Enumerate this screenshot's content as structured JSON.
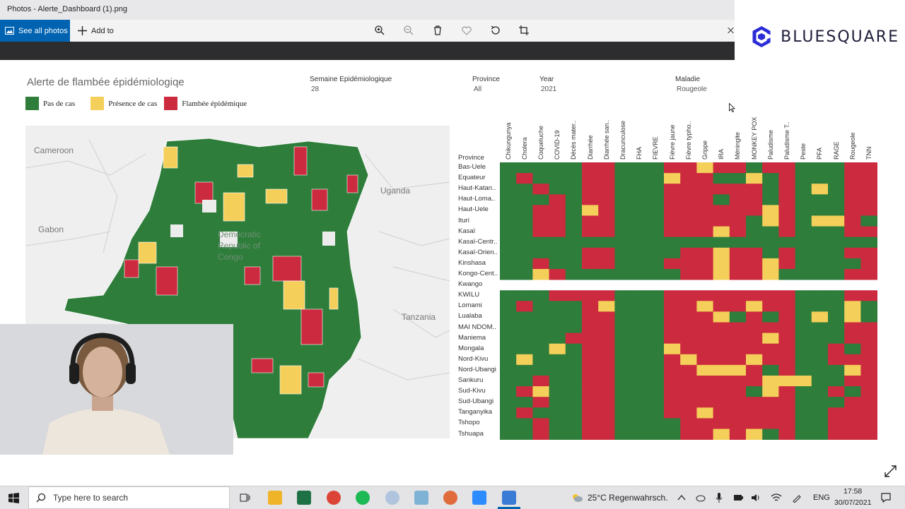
{
  "window": {
    "title": "Photos - Alerte_Dashboard (1).png"
  },
  "toolbar": {
    "see_all_label": "See all photos",
    "add_to_label": "Add to"
  },
  "brand": {
    "name": "BLUESQUARE",
    "color": "#2b2bd8"
  },
  "dashboard": {
    "title": "Alerte de flambée épidémiologiqe",
    "legend": [
      {
        "label": "Pas de cas",
        "color": "#2e7d3b"
      },
      {
        "label": "Présence de cas",
        "color": "#f4cf5a"
      },
      {
        "label": "Flambée épidémique",
        "color": "#cc2a3e"
      }
    ],
    "filters": {
      "semaine": {
        "label": "Semaine Epidémiologique",
        "value": "28"
      },
      "province": {
        "label": "Province",
        "value": "All"
      },
      "year": {
        "label": "Year",
        "value": "2021"
      },
      "maladie": {
        "label": "Maladie",
        "value": "Rougeole"
      }
    },
    "map_labels": [
      "Cameroon",
      "Gabon",
      "Uganda",
      "Tanzania",
      "Democratic Republic of Congo"
    ],
    "province_header": "Province"
  },
  "chart_data": {
    "type": "heatmap",
    "columns": [
      "Chikungunya",
      "Cholera",
      "Coqueluche",
      "COVID-19",
      "Décès mater..",
      "Diarrhée",
      "Diarrhée san..",
      "Dracunculose",
      "FHA",
      "FIEVRE",
      "Fièvre jaune",
      "Fièvre typho..",
      "Grippe",
      "IRA",
      "Méningite",
      "MONKEY POX",
      "Paludisme",
      "Paludisme T..",
      "Peste",
      "PFA",
      "RAGE",
      "Rougeole",
      "TNN"
    ],
    "rows": [
      "Bas-Uele",
      "Equateur",
      "Haut-Katan..",
      "Haut-Loma..",
      "Haut-Uele",
      "Ituri",
      "Kasaï",
      "Kasaï-Centr..",
      "Kasaï-Orien..",
      "Kinshasa",
      "Kongo-Cent..",
      "Kwango",
      "KWILU",
      "Lomami",
      "Lualaba",
      "MAI NDOM..",
      "Maniema",
      "Mongala",
      "Nord-Kivu",
      "Nord-Ubangi",
      "Sankuru",
      "Sud-Kivu",
      "Sud-Ubangi",
      "Tanganyika",
      "Tshopo",
      "Tshuapa"
    ],
    "legend": {
      "0": "Pas de cas",
      "1": "Présence de cas",
      "2": "Flambée épidémique"
    },
    "values": [
      "00000220002212202200022",
      "02000220001220010200022",
      "00200220002222220201022",
      "00020220002220220200022",
      "00220120002222221200022",
      "00220220002222201201120",
      "00220220002221200200022",
      "00000000000000000000000",
      "00000220000221220200022",
      "00200220002221221200002",
      "00120000000221221000022",
      "",
      "00022220002222222200022",
      "02000210002212212200010",
      "00000220002221020201010",
      "00000220002222222200022",
      "00002220002222221200022",
      "00010220001222222200202",
      "01000220002122212200222",
      "00000220002211120200012",
      "00200220002222221110022",
      "02100220002222201200202",
      "00200220002222222200022",
      "02000220002212222200222",
      "00200220000222222200222",
      "00200220000221210200222"
    ]
  },
  "webcam": {
    "name": "presenter-webcam"
  },
  "taskbar": {
    "search_placeholder": "Type here to search",
    "weather": "25°C  Regenwahrsch.",
    "lang": "ENG",
    "time": "17:58",
    "date": "30/07/2021"
  }
}
